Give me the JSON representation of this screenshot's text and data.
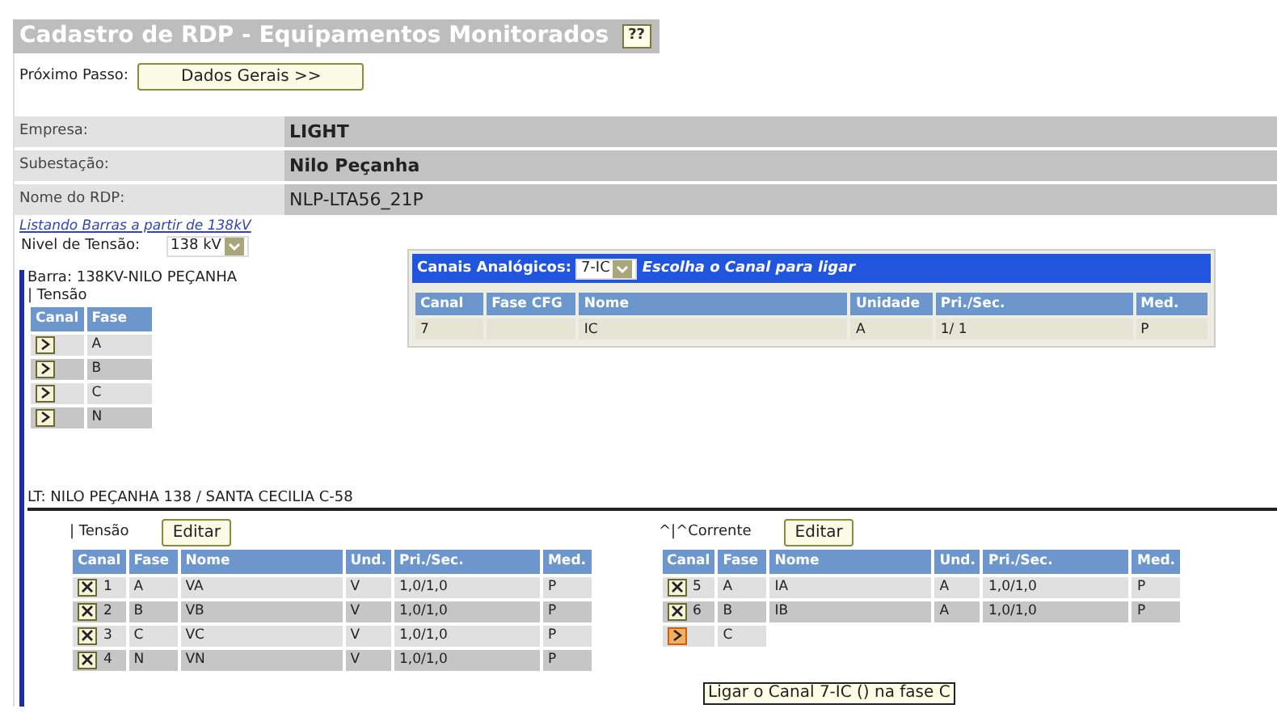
{
  "title": "Cadastro de RDP - Equipamentos Monitorados",
  "help_button": "??",
  "next_step": {
    "label": "Próximo Passo:",
    "button": "Dados Gerais >>"
  },
  "info": [
    {
      "label": "Empresa:",
      "value": "LIGHT",
      "emphasis": true
    },
    {
      "label": "Subestação:",
      "value": "Nilo Peçanha",
      "emphasis": true
    },
    {
      "label": "Nome do RDP:",
      "value": "NLP-LTA56_21P",
      "emphasis": false
    }
  ],
  "listing_link": "Listando Barras a partir de 138kV",
  "voltage_level": {
    "label": "Nivel de Tensão:",
    "value": "138 kV"
  },
  "analog_channels": {
    "label": "Canais Analógicos:",
    "value": "7-IC",
    "hint": "Escolha o Canal para ligar",
    "columns": [
      "Canal",
      "Fase CFG",
      "Nome",
      "Unidade",
      "Pri./Sec.",
      "Med."
    ],
    "rows": [
      {
        "canal": "7",
        "nome": "IC",
        "unidade": "A",
        "pri_sec": "1/ 1",
        "med": "P"
      }
    ]
  },
  "bus": {
    "label": "Barra: 138KV-NILO PEÇANHA",
    "group": "| Tensão",
    "columns": [
      "Canal",
      "Fase"
    ],
    "rows": [
      {
        "kind": "connect",
        "fase": "A"
      },
      {
        "kind": "connect",
        "fase": "B"
      },
      {
        "kind": "connect",
        "fase": "C"
      },
      {
        "kind": "connect",
        "fase": "N"
      }
    ]
  },
  "line": {
    "label": "LT:  NILO PEÇANHA 138 / SANTA CECILIA C-58",
    "groups": [
      {
        "title": "| Tensão",
        "button": "Editar",
        "columns": [
          "Canal",
          "Fase",
          "Nome",
          "Und.",
          "Pri./Sec.",
          "Med."
        ],
        "rows": [
          {
            "kind": "remove",
            "hover": false,
            "canal": "1",
            "fase": "A",
            "nome": "VA",
            "und": "V",
            "pri_sec": "1,0/1,0",
            "med": "P"
          },
          {
            "kind": "remove",
            "hover": false,
            "canal": "2",
            "fase": "B",
            "nome": "VB",
            "und": "V",
            "pri_sec": "1,0/1,0",
            "med": "P"
          },
          {
            "kind": "remove",
            "hover": false,
            "canal": "3",
            "fase": "C",
            "nome": "VC",
            "und": "V",
            "pri_sec": "1,0/1,0",
            "med": "P"
          },
          {
            "kind": "remove",
            "hover": false,
            "canal": "4",
            "fase": "N",
            "nome": "VN",
            "und": "V",
            "pri_sec": "1,0/1,0",
            "med": "P"
          }
        ]
      },
      {
        "title": "^|^Corrente",
        "button": "Editar",
        "columns": [
          "Canal",
          "Fase",
          "Nome",
          "Und.",
          "Pri./Sec.",
          "Med."
        ],
        "rows": [
          {
            "kind": "remove",
            "hover": false,
            "canal": "5",
            "fase": "A",
            "nome": "IA",
            "und": "A",
            "pri_sec": "1,0/1,0",
            "med": "P"
          },
          {
            "kind": "remove",
            "hover": false,
            "canal": "6",
            "fase": "B",
            "nome": "IB",
            "und": "A",
            "pri_sec": "1,0/1,0",
            "med": "P"
          },
          {
            "kind": "connect",
            "hover": true,
            "fase": "C"
          }
        ]
      }
    ]
  },
  "tooltip": "Ligar o Canal 7-IC () na fase C"
}
